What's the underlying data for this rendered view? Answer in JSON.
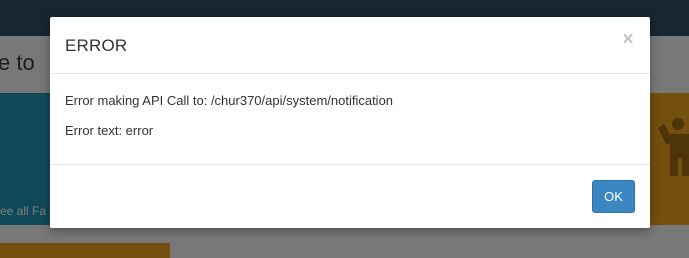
{
  "background": {
    "heading_fragment": "e to",
    "link_fragment": "ee all Fa"
  },
  "modal": {
    "title": "ERROR",
    "close_glyph": "×",
    "body": {
      "api_message": "Error making API Call to: /chur370/api/system/notification",
      "error_text": "Error text: error"
    },
    "ok_label": "OK"
  },
  "colors": {
    "topbar": "#2f4d63",
    "teal_panel": "#1f93b3",
    "orange_panel": "#e9a01e",
    "ok_button": "#3a87c1"
  },
  "icons": {
    "background_orange_panel": "person-icon"
  }
}
